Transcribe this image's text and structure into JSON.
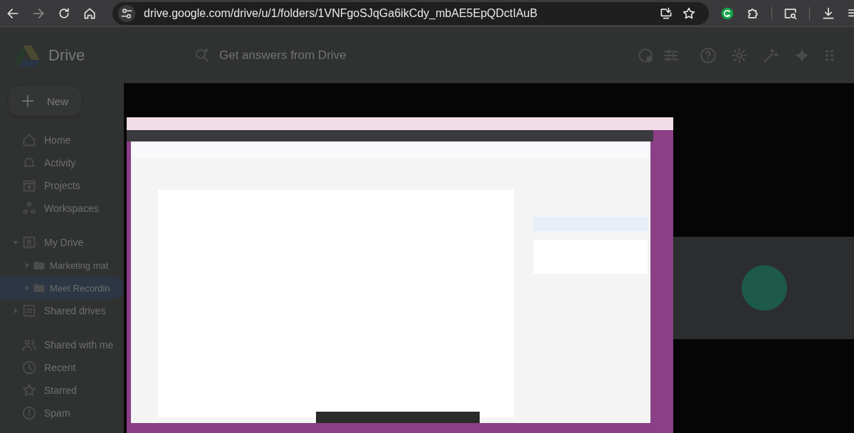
{
  "browser": {
    "url": "drive.google.com/drive/u/1/folders/1VNFgoSJqGa6ikCdy_mbAE5EpQDctIAuB"
  },
  "header": {
    "app_name": "Drive",
    "search": {
      "placeholder": "Get answers from Drive"
    }
  },
  "sidebar": {
    "new_button": "New",
    "nav": [
      {
        "label": "Home",
        "selected": false
      },
      {
        "label": "Activity",
        "selected": false
      },
      {
        "label": "Projects",
        "selected": false
      },
      {
        "label": "Workspaces",
        "selected": false
      }
    ],
    "tree": [
      {
        "label": "My Drive",
        "selected": false,
        "expanded": true,
        "children": [
          {
            "label": "Marketing mat",
            "selected": false,
            "expanded": false
          },
          {
            "label": "Meet Recordin",
            "selected": true,
            "expanded": false
          }
        ]
      },
      {
        "label": "Shared drives",
        "selected": false,
        "expanded": false
      }
    ],
    "more": [
      {
        "label": "Shared with me",
        "selected": false
      },
      {
        "label": "Recent",
        "selected": false
      },
      {
        "label": "Starred",
        "selected": false
      },
      {
        "label": "Spam",
        "selected": false
      }
    ]
  }
}
